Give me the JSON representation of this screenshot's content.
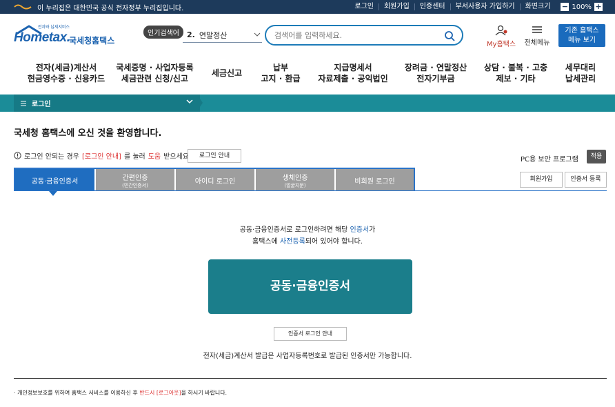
{
  "govbar": {
    "notice": "이 누리집은 대한민국 공식 전자정부 누리집입니다.",
    "links": [
      "로그인",
      "회원가입",
      "인증센터",
      "부서사용자 가입하기",
      "화면크기"
    ],
    "zoom_minus": "−",
    "zoom_value": "100%",
    "zoom_plus": "+"
  },
  "header": {
    "logo_brand": "Hometax.",
    "logo_small": "전자와 납세서비스",
    "logo_kor": "국세청홈택스",
    "popular_tag": "인기검색어",
    "popular_num": "2.",
    "popular_item": "연말정산",
    "search_placeholder": "검색어를 입력하세요.",
    "my_home": "My홈택스",
    "all_menu": "전체메뉴",
    "old_menu_line1": "기존 홈택스",
    "old_menu_line2": "메뉴 보기"
  },
  "mainnav": [
    {
      "line1": "전자(세금)계산서",
      "line2": "현금영수증 · 신용카드"
    },
    {
      "line1": "국세증명 · 사업자등록",
      "line2": "세금관련 신청/신고"
    },
    {
      "line1": "세금신고",
      "line2": ""
    },
    {
      "line1": "납부",
      "line2": "고지 · 환급"
    },
    {
      "line1": "지급명세서",
      "line2": "자료제출 · 공익법인"
    },
    {
      "line1": "장려금 · 연말정산",
      "line2": "전자기부금"
    },
    {
      "line1": "상담 · 불복 · 고충",
      "line2": "제보 · 기타"
    },
    {
      "line1": "세무대리",
      "line2": "납세관리"
    }
  ],
  "breadcrumb": {
    "label": "로그인"
  },
  "welcome": "국세청 홈택스에 오신 것을 환영합니다.",
  "help": {
    "prefix": "로그인 안되는 경우",
    "link1": "[로그인 안내]",
    "mid": "를 눌러",
    "link2": "도움",
    "suffix": "받으세요.",
    "button": "로그인 안내"
  },
  "pc_security": {
    "label": "PC용 보안 프로그램",
    "button": "적용"
  },
  "tabs": [
    {
      "label": "공동·금융인증서",
      "sub": ""
    },
    {
      "label": "간편인증",
      "sub": "(민간인증서)"
    },
    {
      "label": "아이디 로그인",
      "sub": ""
    },
    {
      "label": "생체인증",
      "sub": "(얼굴지문)"
    },
    {
      "label": "비회원 로그인",
      "sub": ""
    }
  ],
  "side_buttons": {
    "join": "회원가입",
    "cert_register": "인증서 등록"
  },
  "info": {
    "line1_a": "공동·금융인증서로 로그인하려면 해당 ",
    "line1_b": "인증서",
    "line1_c": "가",
    "line2_a": "홈택스에 ",
    "line2_b": "사전등록",
    "line2_c": "되어 있어야 합니다."
  },
  "cert_button": "공동·금융인증서",
  "cert_guide": "인증서 로그인 안내",
  "cert_note": "전자(세금)계산서 발급은 사업자등록번호로 발급된 인증서만 가능합니다.",
  "privacy": {
    "bullet": "·",
    "a": "개인정보보호를 위하여 홈택스 서비스를 이용하신 후 ",
    "b": "반드시 [로그아웃]",
    "c": "을 하시기 바랍니다."
  },
  "colors": {
    "accent": "#1b8c98",
    "tab_active": "#1f6dc0",
    "brand": "#1c63b0"
  }
}
